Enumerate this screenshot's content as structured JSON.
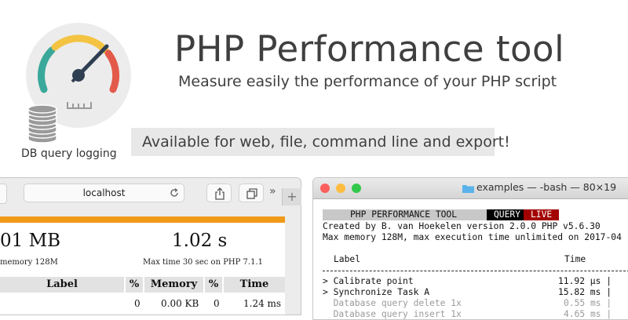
{
  "hero": {
    "title": "PHP Performance tool",
    "subtitle": "Measure easily the performance of your PHP script",
    "availability": "Available for web, file, command line and export!",
    "db_caption": "DB query logging",
    "gauge_ticks": "LLLL"
  },
  "browser": {
    "address": "localhost",
    "more_label": "»",
    "new_tab_label": "+",
    "stats": {
      "memory_value": "01 MB",
      "memory_caption": "memory 128M",
      "time_value": "1.02 s",
      "time_caption": "Max time 30 sec on PHP 7.1.1"
    },
    "table": {
      "headers": [
        "Label",
        "%",
        "Memory",
        "%",
        "Time"
      ],
      "rows": [
        [
          "",
          "0",
          "0.00 KB",
          "0",
          "1.24 ms"
        ]
      ]
    }
  },
  "terminal": {
    "title": "examples — -bash — 80×19",
    "banner": "PHP PERFORMANCE TOOL",
    "query_tag": "QUERY",
    "live_tag": "LIVE",
    "line_created": "Created by B. van Hoekelen version 2.0.0 PHP v5.6.30",
    "line_memory": "Max memory 128M, max execution time unlimited on 2017-04",
    "col_label": "Label",
    "col_time": "Time",
    "rows": [
      {
        "label": "> Calibrate point",
        "time": "11.92 μs |"
      },
      {
        "label": "> Synchronize Task A",
        "time": "15.82 ms |"
      },
      {
        "label": "  Database query delete 1x",
        "time": "0.55 ms |"
      },
      {
        "label": "  Database query insert 1x",
        "time": "4.65 ms |"
      }
    ]
  },
  "colors": {
    "accent_orange": "#f09a1a",
    "terminal_live_red": "#a30000",
    "gauge_teal": "#3aa89a",
    "gauge_yellow": "#f3c341",
    "gauge_red": "#e35a4a"
  }
}
